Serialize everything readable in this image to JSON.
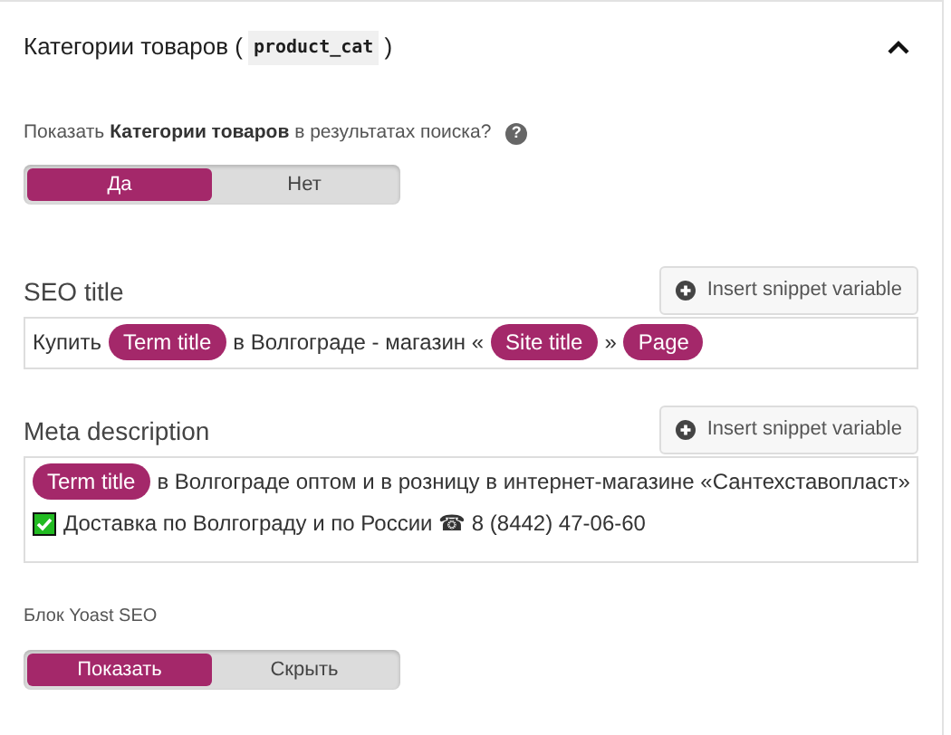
{
  "header": {
    "title": "Категории товаров (",
    "code": "product_cat",
    "title_end": ")",
    "expanded": true
  },
  "search_setting": {
    "question": "Показать **Категории товаров** в результатах поиска?",
    "help": "?",
    "options": [
      {
        "label": "Да",
        "selected": true
      },
      {
        "label": "Нет",
        "selected": false
      }
    ]
  },
  "fields": [
    {
      "label": "SEO title",
      "button": "Insert snippet variable",
      "lines": [
        [
          {
            "kind": "text",
            "text": "Купить"
          },
          {
            "kind": "variable",
            "text": "Term title"
          },
          {
            "kind": "text",
            "text": "в Волгограде - магазин «"
          },
          {
            "kind": "variable",
            "text": "Site title"
          },
          {
            "kind": "text",
            "text": "»"
          },
          {
            "kind": "variable",
            "text": "Page"
          }
        ]
      ]
    },
    {
      "label": "Meta description",
      "button": "Insert snippet variable",
      "lines": [
        [
          {
            "kind": "variable",
            "text": "Term title"
          },
          {
            "kind": "text",
            "text": "в Волгограде оптом и в розницу в интернет-магазине «Сантехставопласт»"
          }
        ],
        [
          {
            "kind": "check"
          },
          {
            "kind": "text",
            "text": "Доставка по Волгограду и по России ☎ 8 (8442) 47-06-60"
          }
        ]
      ]
    }
  ],
  "yoast_block": {
    "label": "Блок Yoast SEO",
    "options": [
      {
        "label": "Показать",
        "selected": true
      },
      {
        "label": "Скрыть",
        "selected": false
      }
    ]
  }
}
